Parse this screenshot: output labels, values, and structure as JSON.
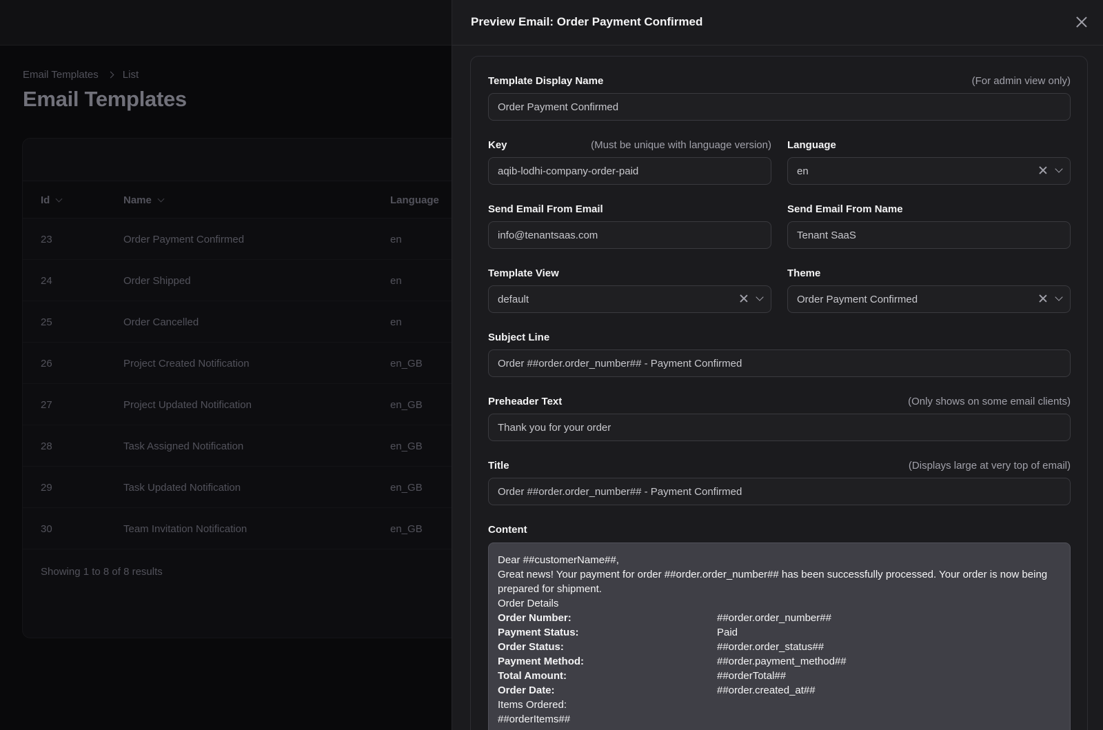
{
  "background": {
    "breadcrumb": [
      "Email Templates",
      "List"
    ],
    "page_title": "Email Templates",
    "table": {
      "columns": [
        "Id",
        "Name",
        "Language"
      ],
      "rows": [
        {
          "id": "23",
          "name": "Order Payment Confirmed",
          "language": "en"
        },
        {
          "id": "24",
          "name": "Order Shipped",
          "language": "en"
        },
        {
          "id": "25",
          "name": "Order Cancelled",
          "language": "en"
        },
        {
          "id": "26",
          "name": "Project Created Notification",
          "language": "en_GB"
        },
        {
          "id": "27",
          "name": "Project Updated Notification",
          "language": "en_GB"
        },
        {
          "id": "28",
          "name": "Task Assigned Notification",
          "language": "en_GB"
        },
        {
          "id": "29",
          "name": "Task Updated Notification",
          "language": "en_GB"
        },
        {
          "id": "30",
          "name": "Team Invitation Notification",
          "language": "en_GB"
        }
      ],
      "footer": "Showing 1 to 8 of 8 results"
    }
  },
  "drawer": {
    "title": "Preview Email: Order Payment Confirmed",
    "fields": {
      "display_name": {
        "label": "Template Display Name",
        "hint": "(For admin view only)",
        "value": "Order Payment Confirmed"
      },
      "key": {
        "label": "Key",
        "hint": "(Must be unique with language version)",
        "value": "aqib-lodhi-company-order-paid"
      },
      "language": {
        "label": "Language",
        "value": "en"
      },
      "from_email": {
        "label": "Send Email From Email",
        "value": "info@tenantsaas.com"
      },
      "from_name": {
        "label": "Send Email From Name",
        "value": "Tenant SaaS"
      },
      "template_view": {
        "label": "Template View",
        "value": "default"
      },
      "theme": {
        "label": "Theme",
        "value": "Order Payment Confirmed"
      },
      "subject": {
        "label": "Subject Line",
        "value": "Order ##order.order_number## - Payment Confirmed"
      },
      "preheader": {
        "label": "Preheader Text",
        "hint": "(Only shows on some email clients)",
        "value": "Thank you for your order"
      },
      "title": {
        "label": "Title",
        "hint": "(Displays large at very top of email)",
        "value": "Order ##order.order_number## - Payment Confirmed"
      },
      "content": {
        "label": "Content",
        "greeting": "Dear ##customerName##,",
        "body": "Great news! Your payment for order ##order.order_number## has been successfully processed. Your order is now being prepared for shipment.",
        "details_heading": "Order Details",
        "details": [
          {
            "key": "Order Number:",
            "value": "##order.order_number##"
          },
          {
            "key": "Payment Status:",
            "value": "Paid"
          },
          {
            "key": "Order Status:",
            "value": "##order.order_status##"
          },
          {
            "key": "Payment Method:",
            "value": "##order.payment_method##"
          },
          {
            "key": "Total Amount:",
            "value": "##orderTotal##"
          },
          {
            "key": "Order Date:",
            "value": "##order.created_at##"
          }
        ],
        "items_heading": "Items Ordered:",
        "items_placeholder": "##orderItems##"
      }
    }
  }
}
